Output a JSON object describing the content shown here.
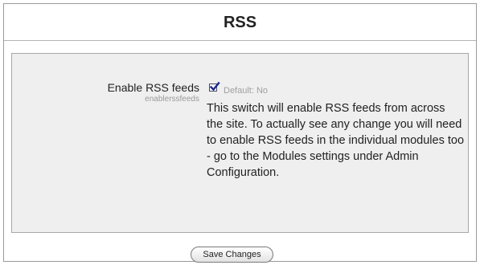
{
  "page": {
    "title": "RSS"
  },
  "setting": {
    "label": "Enable RSS feeds",
    "name": "enablerssfeeds",
    "checked": true,
    "default_text": "Default: No",
    "description": "This switch will enable RSS feeds from across the site. To actually see any change you will need to enable RSS feeds in the individual modules too - go to the Modules settings under Admin Configuration."
  },
  "actions": {
    "save_label": "Save Changes"
  },
  "colors": {
    "panel_background": "#efefef",
    "checkmark": "#1b2a8a",
    "muted_text": "#9a9a9a"
  },
  "icons": {
    "checkbox": "checkmark-icon"
  }
}
